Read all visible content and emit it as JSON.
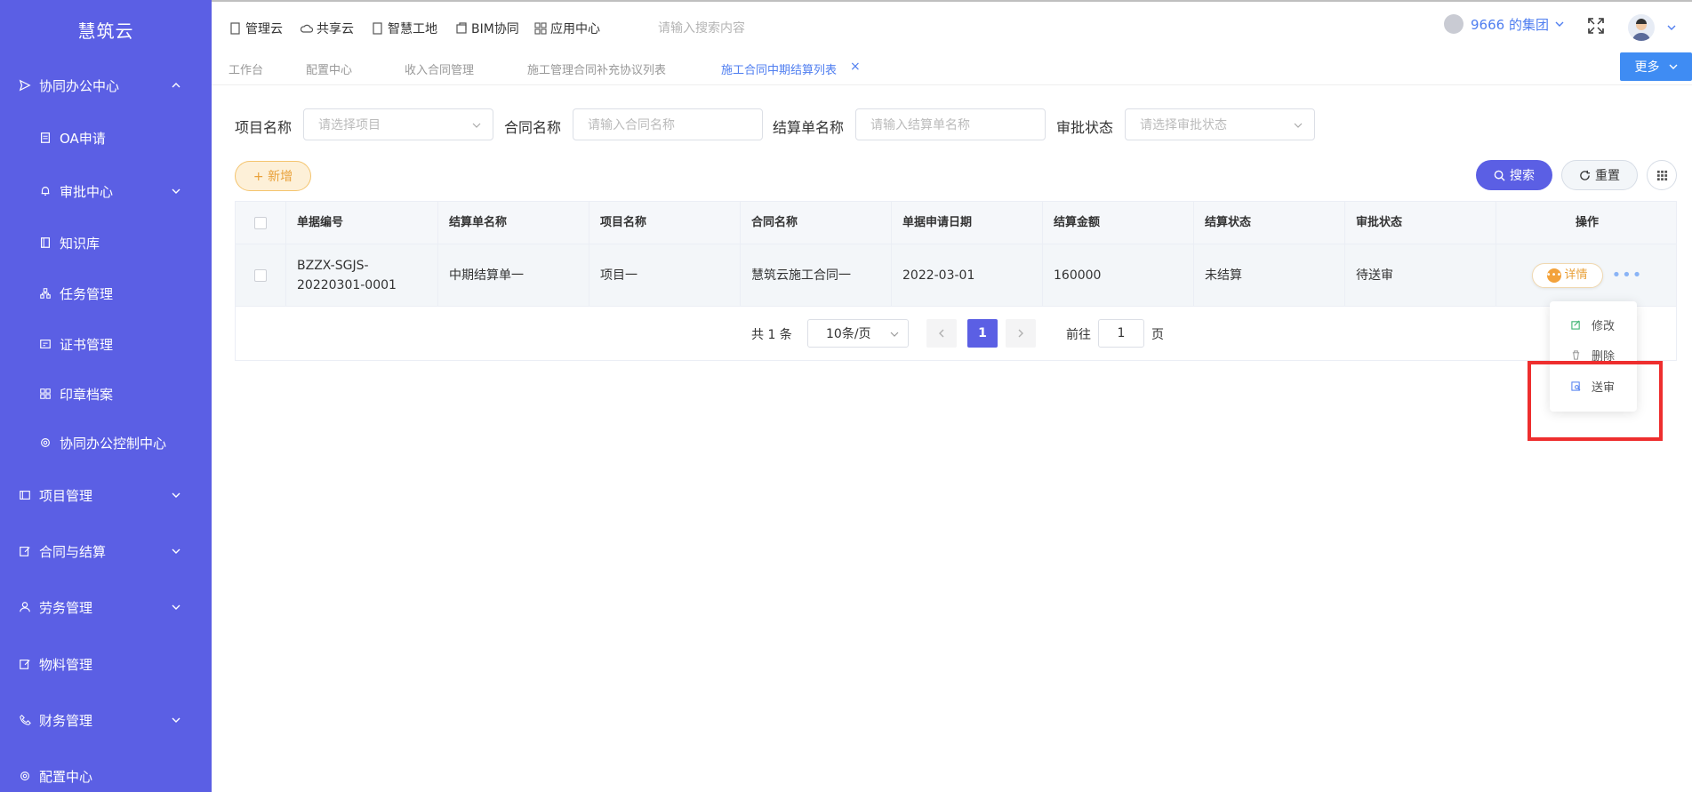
{
  "sidebar": {
    "brand": "慧筑云",
    "items": [
      {
        "label": "协同办公中心",
        "icon": "send-icon"
      },
      {
        "label": "OA申请",
        "icon": "document-icon"
      },
      {
        "label": "审批中心",
        "icon": "bell-icon"
      },
      {
        "label": "知识库",
        "icon": "book-icon"
      },
      {
        "label": "任务管理",
        "icon": "sitemap-icon"
      },
      {
        "label": "证书管理",
        "icon": "certificate-icon"
      },
      {
        "label": "印章档案",
        "icon": "grid-icon"
      },
      {
        "label": "协同办公控制中心",
        "icon": "gear-icon"
      },
      {
        "label": "项目管理",
        "icon": "folder-icon"
      },
      {
        "label": "合同与结算",
        "icon": "edit-icon"
      },
      {
        "label": "劳务管理",
        "icon": "user-icon"
      },
      {
        "label": "物料管理",
        "icon": "edit-icon"
      },
      {
        "label": "财务管理",
        "icon": "phone-icon"
      },
      {
        "label": "配置中心",
        "icon": "gear-icon"
      }
    ]
  },
  "topbar": {
    "links": [
      "管理云",
      "共享云",
      "智慧工地",
      "BIM协同",
      "应用中心"
    ],
    "search_placeholder": "请输入搜索内容",
    "group": "9666 的集团"
  },
  "tabs": {
    "items": [
      "工作台",
      "配置中心",
      "收入合同管理",
      "施工管理合同补充协议列表",
      "施工合同中期结算列表"
    ],
    "close": "×",
    "more": "更多"
  },
  "filters": {
    "project_label": "项目名称",
    "project_placeholder": "请选择项目",
    "contract_label": "合同名称",
    "contract_placeholder": "请输入合同名称",
    "settle_label": "结算单名称",
    "settle_placeholder": "请输入结算单名称",
    "status_label": "审批状态",
    "status_placeholder": "请选择审批状态"
  },
  "actions": {
    "add": "+ 新增",
    "search": "搜索",
    "reset": "重置"
  },
  "table": {
    "headers": [
      "单据编号",
      "结算单名称",
      "项目名称",
      "合同名称",
      "单据申请日期",
      "结算金额",
      "结算状态",
      "审批状态",
      "操作"
    ],
    "rows": [
      {
        "code": "BZZX-SGJS-20220301-0001",
        "settle_name": "中期结算单一",
        "project": "项目一",
        "contract": "慧筑云施工合同一",
        "date": "2022-03-01",
        "amount": "160000",
        "settle_status": "未结算",
        "approval_status": "待送审",
        "detail": "详情"
      }
    ]
  },
  "pagination": {
    "total": "共 1 条",
    "page_size": "10条/页",
    "current": "1",
    "goto_prefix": "前往",
    "goto_value": "1",
    "goto_suffix": "页"
  },
  "dropdown": {
    "edit": "修改",
    "delete": "删除",
    "submit": "送审"
  }
}
